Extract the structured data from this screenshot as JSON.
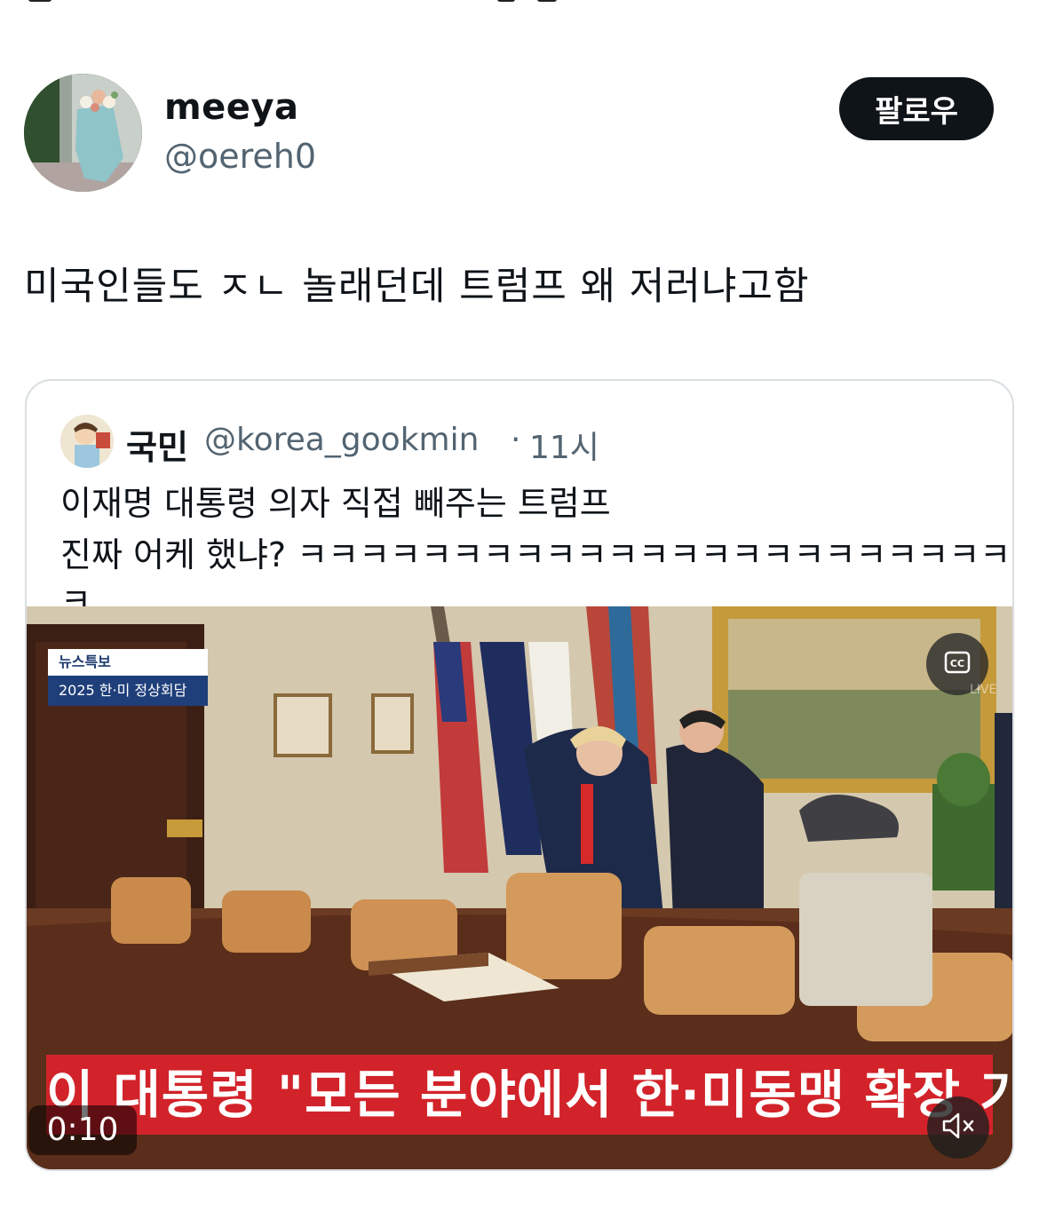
{
  "tweet": {
    "author_name": "meeya",
    "author_handle": "@oereh0",
    "follow_label": "팔로우",
    "text": "미국인들도 ㅈㄴ 놀래던데 트럼프 왜 저러냐고함"
  },
  "quoted_tweet": {
    "author_name": "국민",
    "author_handle": "@korea_gookmin",
    "separator": "·",
    "time": "11시",
    "line1": "이재명 대통령 의자 직접 빼주는 트럼프",
    "line2": "진짜 어케 했냐? ㅋㅋㅋㅋㅋㅋㅋㅋㅋㅋㅋㅋㅋㅋㅋㅋㅋㅋㅋㅋㅋㅋㅋㅋ",
    "video": {
      "news_label": "뉴스특보",
      "news_subtitle": "2025 한·미 정상회담",
      "caption": "이 대통령 \"모든 분야에서 한·미동맹 확장 기대\"",
      "timestamp": "0:10",
      "cc_icon": "closed-captions-icon",
      "mute_icon": "speaker-muted-icon",
      "live_watermark": "LIVE"
    }
  },
  "colors": {
    "text": "#0f1419",
    "secondary": "#536471",
    "button_bg": "#0f1419",
    "card_border": "#d9dee2",
    "caption_red": "#d2232a",
    "news_blue": "#1f3f7a"
  }
}
